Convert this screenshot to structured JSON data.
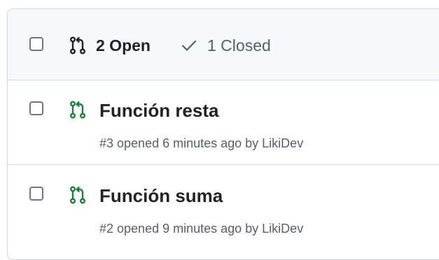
{
  "filters": {
    "open_label": "2 Open",
    "closed_label": "1 Closed"
  },
  "pull_requests": [
    {
      "title": "Función resta",
      "meta": "#3 opened 6 minutes ago by LikiDev"
    },
    {
      "title": "Función suma",
      "meta": "#2 opened 9 minutes ago by LikiDev"
    }
  ],
  "icons": {
    "filter_open": "git-pull-request-icon",
    "filter_closed": "check-icon",
    "row_status": "git-pull-request-open-icon"
  },
  "colors": {
    "open_pr_green": "#1a7f37",
    "header_bg": "#f6f8fa",
    "border": "#d0d7de",
    "muted_text": "#57606a"
  }
}
